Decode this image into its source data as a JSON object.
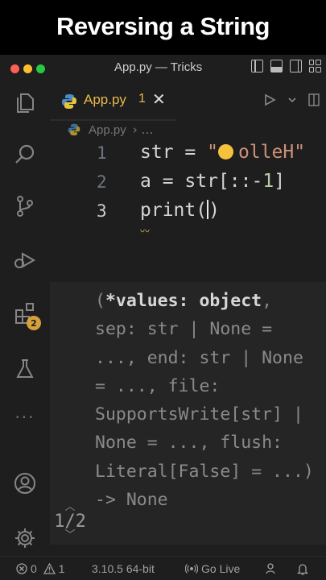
{
  "banner": {
    "title": "Reversing a String"
  },
  "window": {
    "title": "App.py — Tricks"
  },
  "tab": {
    "label": "App.py",
    "problems": "1",
    "close": "✕"
  },
  "breadcrumb": {
    "file": "App.py",
    "sep": "› …"
  },
  "code": {
    "line_numbers": [
      "1",
      "2",
      "3"
    ],
    "line1": {
      "name": "str",
      "op": " = ",
      "str_open": "\"",
      "str_text": "olleH\""
    },
    "line2": {
      "name": "a",
      "op": " = ",
      "expr": "str[::",
      "minus": "-",
      "num": "1",
      "close": "]"
    },
    "line3": {
      "fn": "print",
      "paren": "(",
      "close": ")"
    }
  },
  "signature_help": {
    "open": "(",
    "active_param": "*values: object",
    "rest": ", sep: str | None = ..., end: str | None = ..., file: SupportsWrite[str] | None = ..., flush: Literal[False] = ...) -> None",
    "overload": "1/2"
  },
  "status": {
    "errors": "0",
    "warnings": "1",
    "python": "3.10.5 64-bit",
    "golive": "Go Live"
  },
  "activity": {
    "badge": "2"
  },
  "colors": {
    "accent_tab": "#e8b94a",
    "string": "#ce9178",
    "number": "#b5cea8",
    "badge": "#d4a13a"
  }
}
